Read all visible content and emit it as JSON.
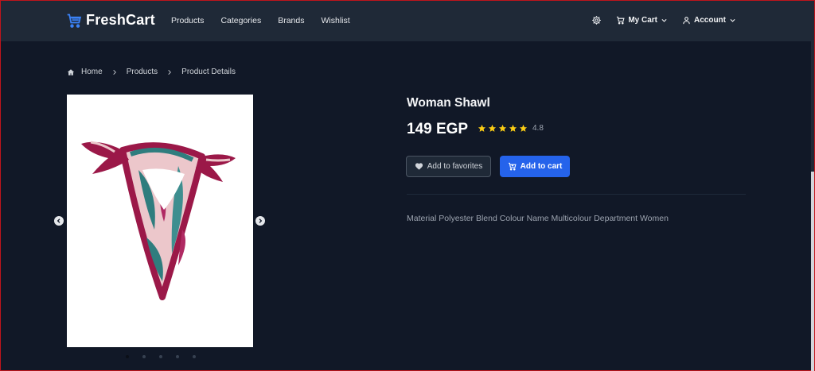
{
  "brand": {
    "name": "FreshCart",
    "icon": "cart-icon",
    "color": "#3b82f6"
  },
  "nav": {
    "links": [
      "Products",
      "Categories",
      "Brands",
      "Wishlist"
    ],
    "cart_label": "My Cart",
    "account_label": "Account"
  },
  "breadcrumb": [
    "Home",
    "Products",
    "Product Details"
  ],
  "product": {
    "title": "Woman Shawl",
    "price": "149 EGP",
    "rating": "4.8",
    "rating_stars": 5,
    "description": "Material Polyester Blend Colour Name Multicolour Department Women",
    "favorites_label": "Add to favorites",
    "cart_label": "Add to cart",
    "image_count": 5,
    "active_image": 0
  },
  "colors": {
    "accent": "#2563eb",
    "star": "#facc15",
    "background": "#111827",
    "navbar": "#1f2937"
  }
}
